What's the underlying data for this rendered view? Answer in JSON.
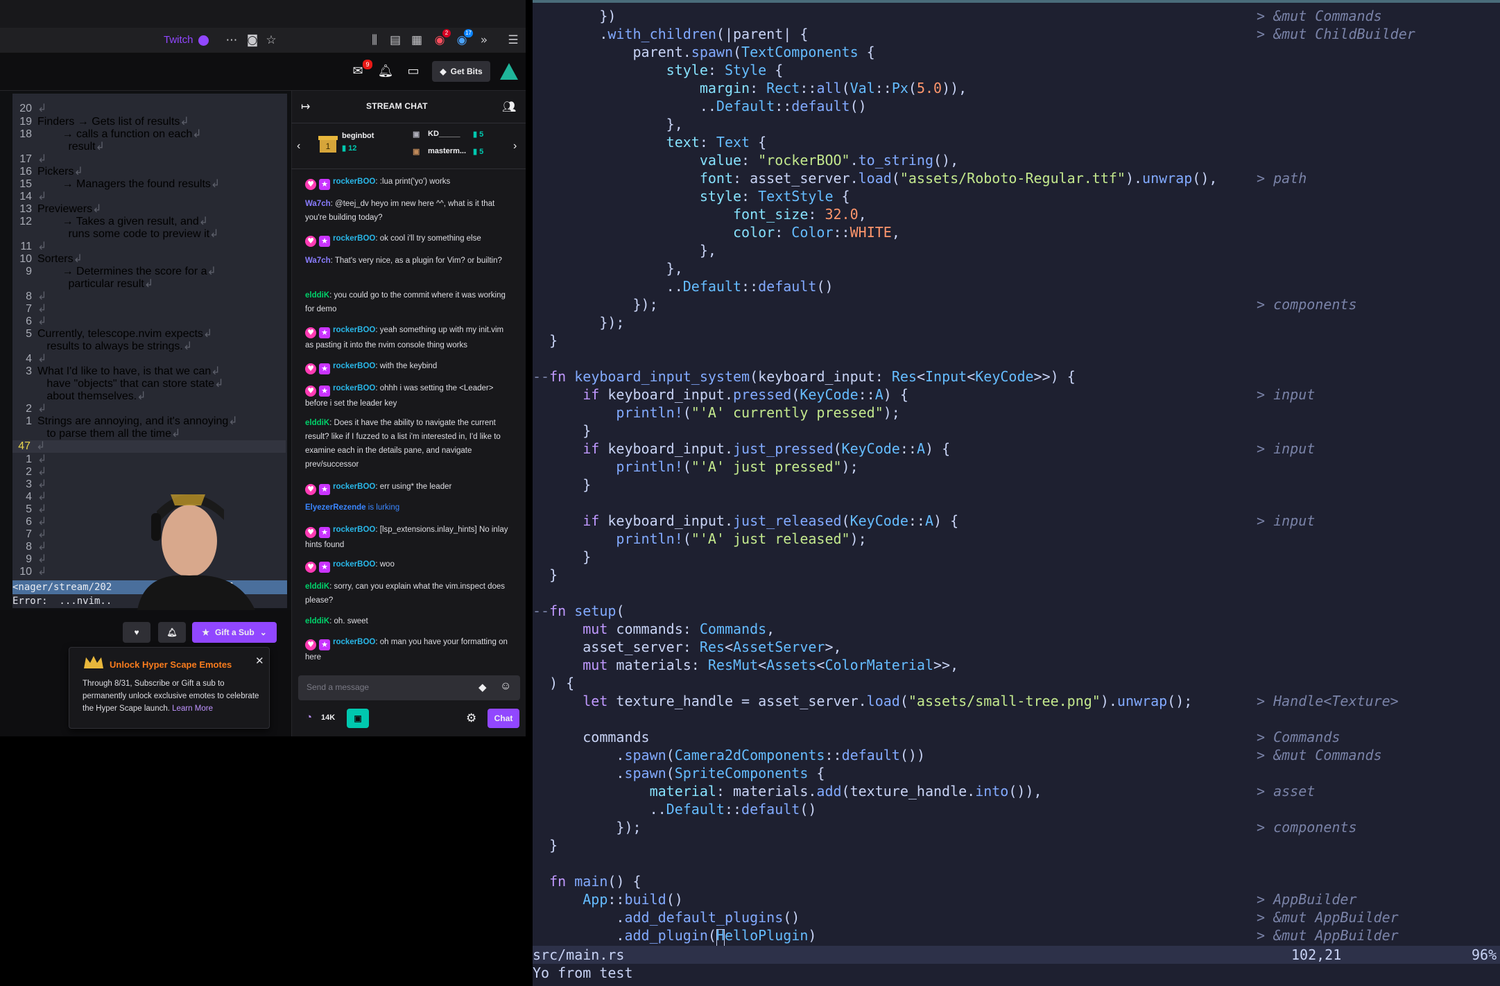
{
  "browser": {
    "twitch_tab": "Twitch",
    "badges": {
      "extension_red": "2",
      "extension_blue": "17"
    },
    "notification_count": "9",
    "get_bits": "Get Bits"
  },
  "terminal": {
    "lines": [
      {
        "n": "20",
        "text": ""
      },
      {
        "n": "19",
        "text": "Finders → Gets list of results"
      },
      {
        "n": "18",
        "text": "        → calls a function on each"
      },
      {
        "n": "",
        "text": "          result"
      },
      {
        "n": "17",
        "text": ""
      },
      {
        "n": "16",
        "text": "Pickers"
      },
      {
        "n": "15",
        "text": "        → Managers the found results"
      },
      {
        "n": "14",
        "text": ""
      },
      {
        "n": "13",
        "text": "Previewers"
      },
      {
        "n": "12",
        "text": "        → Takes a given result, and"
      },
      {
        "n": "",
        "text": "          runs some code to preview it"
      },
      {
        "n": "11",
        "text": ""
      },
      {
        "n": "10",
        "text": "Sorters"
      },
      {
        "n": "9",
        "text": "        → Determines the score for a"
      },
      {
        "n": "",
        "text": "          particular result"
      },
      {
        "n": "8",
        "text": ""
      },
      {
        "n": "7",
        "text": ""
      },
      {
        "n": "6",
        "text": ""
      },
      {
        "n": "5",
        "text": "Currently, telescope.nvim expects"
      },
      {
        "n": "",
        "text": "   results to always be strings."
      },
      {
        "n": "4",
        "text": ""
      },
      {
        "n": "3",
        "text": "What I'd like to have, is that we can"
      },
      {
        "n": "",
        "text": "   have \"objects\" that can store state"
      },
      {
        "n": "",
        "text": "   about themselves."
      },
      {
        "n": "2",
        "text": ""
      },
      {
        "n": "1",
        "text": "Strings are annoying, and it's annoying"
      },
      {
        "n": "",
        "text": "   to parse them all the time"
      },
      {
        "n": "47",
        "text": ""
      },
      {
        "n": "1",
        "text": ""
      },
      {
        "n": "2",
        "text": ""
      },
      {
        "n": "3",
        "text": ""
      },
      {
        "n": "4",
        "text": ""
      },
      {
        "n": "5",
        "text": ""
      },
      {
        "n": "6",
        "text": ""
      },
      {
        "n": "7",
        "text": ""
      },
      {
        "n": "8",
        "text": ""
      },
      {
        "n": "9",
        "text": ""
      },
      {
        "n": "10",
        "text": ""
      }
    ],
    "status_line": "<nager/stream/202              rkdown]",
    "error_line": "Error:  ...nvim.."
  },
  "below_video": {
    "gift_sub": "Gift a Sub",
    "unlock_title": "Unlock Hyper Scape Emotes",
    "unlock_body": "Through 8/31, Subscribe or Gift a sub to permanently unlock exclusive emotes to celebrate the Hyper Scape launch.",
    "learn_more": "Learn More"
  },
  "chat": {
    "title": "STREAM CHAT",
    "leaders": [
      {
        "name": "beginbot",
        "count": "12"
      },
      {
        "name": "KD_____",
        "count": "5"
      },
      {
        "name": "masterm...",
        "count": "5"
      }
    ],
    "messages": [
      {
        "user": "rockerBOO",
        "color": "#29b7e8",
        "badges": true,
        "text": ":lua print('yo') works"
      },
      {
        "user": "Wa7ch",
        "color": "#8a7dff",
        "badges": false,
        "text": "@teej_dv heyo im new here ^^, what is it that you're building today?"
      },
      {
        "user": "rockerBOO",
        "color": "#29b7e8",
        "badges": true,
        "text": "ok cool i'll try something else"
      },
      {
        "user": "Wa7ch",
        "color": "#8a7dff",
        "badges": false,
        "text": "That's very nice, as a plugin for Vim? or builtin?"
      },
      {
        "user": "elddiK",
        "color": "#00d26a",
        "badges": false,
        "text": "you could go to the commit where it was working for demo"
      },
      {
        "user": "rockerBOO",
        "color": "#29b7e8",
        "badges": true,
        "text": "yeah something up with my init.vim as pasting it into the nvim console thing works"
      },
      {
        "user": "rockerBOO",
        "color": "#29b7e8",
        "badges": true,
        "text": "with the keybind"
      },
      {
        "user": "rockerBOO",
        "color": "#29b7e8",
        "badges": true,
        "text": "ohhh i was setting the <Leader> before i set the leader key"
      },
      {
        "user": "elddiK",
        "color": "#00d26a",
        "badges": false,
        "text": "Does it have the ability to navigate the current result? like if I fuzzed to a list i'm interested in, I'd like to examine each in the details pane, and navigate prev/successor"
      },
      {
        "user": "rockerBOO",
        "color": "#29b7e8",
        "badges": true,
        "text": "err using* the leader"
      },
      {
        "user": "ElyezerRezende",
        "color": "#3a86ff",
        "badges": false,
        "text": "is lurking"
      },
      {
        "user": "rockerBOO",
        "color": "#29b7e8",
        "badges": true,
        "text": "[lsp_extensions.inlay_hints] No inlay hints found"
      },
      {
        "user": "rockerBOO",
        "color": "#29b7e8",
        "badges": true,
        "text": "woo"
      },
      {
        "user": "elddiK",
        "color": "#00d26a",
        "badges": false,
        "text": "sorry, can you explain what the vim.inspect does please?"
      },
      {
        "user": "elddiK",
        "color": "#00d26a",
        "badges": false,
        "text": "oh. sweet"
      },
      {
        "user": "rockerBOO",
        "color": "#29b7e8",
        "badges": true,
        "text": "oh man you have your formatting on here"
      }
    ],
    "input_placeholder": "Send a message",
    "points": "14K",
    "chat_button": "Chat"
  },
  "vim": {
    "status_file": "src/main.rs",
    "status_pos": "102,21",
    "status_pct": "96%",
    "cmdline": "Yo from test",
    "hints": [
      {
        "row": 0,
        "text": "> &mut Commands"
      },
      {
        "row": 1,
        "text": "> &mut ChildBuilder"
      },
      {
        "row": 9,
        "text": "> path"
      },
      {
        "row": 16,
        "text": "> components"
      },
      {
        "row": 21,
        "text": "> input"
      },
      {
        "row": 24,
        "text": "> input"
      },
      {
        "row": 28,
        "text": "> input"
      },
      {
        "row": 38,
        "text": "> Handle<Texture>"
      },
      {
        "row": 40,
        "text": "> Commands"
      },
      {
        "row": 41,
        "text": "> &mut Commands"
      },
      {
        "row": 43,
        "text": "> asset"
      },
      {
        "row": 45,
        "text": "> components"
      },
      {
        "row": 49,
        "text": "> AppBuilder"
      },
      {
        "row": 50,
        "text": "> &mut AppBuilder"
      },
      {
        "row": 51,
        "text": "> &mut AppBuilder"
      }
    ]
  }
}
